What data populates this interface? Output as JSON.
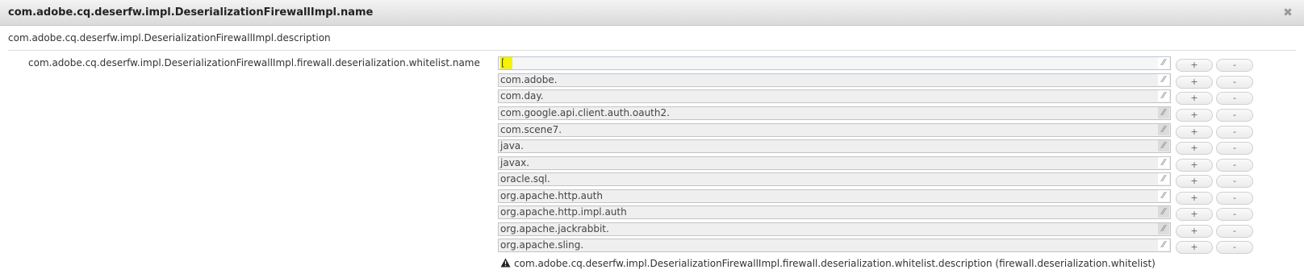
{
  "dialog": {
    "title": "com.adobe.cq.deserfw.impl.DeserializationFirewallImpl.name",
    "close_icon": "close-icon",
    "description": "com.adobe.cq.deserfw.impl.DeserializationFirewallImpl.description"
  },
  "field": {
    "label": "com.adobe.cq.deserfw.impl.DeserializationFirewallImpl.firewall.deserialization.whitelist.name",
    "add_label": "+",
    "remove_label": "-",
    "values": [
      "[",
      "com.adobe.",
      "com.day.",
      "com.google.api.client.auth.oauth2.",
      "com.scene7.",
      "java.",
      "javax.",
      "oracle.sql.",
      "org.apache.http.auth",
      "org.apache.http.impl.auth",
      "org.apache.jackrabbit.",
      "org.apache.sling."
    ],
    "help_icon": "warning-icon",
    "help_text": "com.adobe.cq.deserfw.impl.DeserializationFirewallImpl.firewall.deserialization.whitelist.description (firewall.deserialization.whitelist)"
  },
  "colors": {
    "highlight": "#f4f400",
    "title_bar": "#e4e4e4"
  }
}
